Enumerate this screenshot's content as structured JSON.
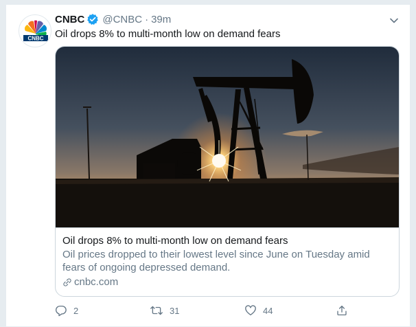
{
  "tweet": {
    "author_name": "CNBC",
    "handle": "@CNBC",
    "separator": "·",
    "time": "39m",
    "text": "Oil drops 8% to multi-month low on demand fears"
  },
  "card": {
    "title": "Oil drops 8% to multi-month low on demand fears",
    "description": "Oil prices dropped to their lowest level since June on Tuesday amid fears of ongoing depressed demand.",
    "domain": "cnbc.com"
  },
  "actions": {
    "reply_count": "2",
    "retweet_count": "31",
    "like_count": "44"
  },
  "colors": {
    "verified": "#1da1f2",
    "secondary_text": "#657786",
    "border": "#ccd6dd"
  },
  "icons": [
    "cnbc-peacock-logo",
    "verified-badge-icon",
    "chevron-down-icon",
    "link-icon",
    "reply-icon",
    "retweet-icon",
    "like-icon",
    "share-icon"
  ]
}
